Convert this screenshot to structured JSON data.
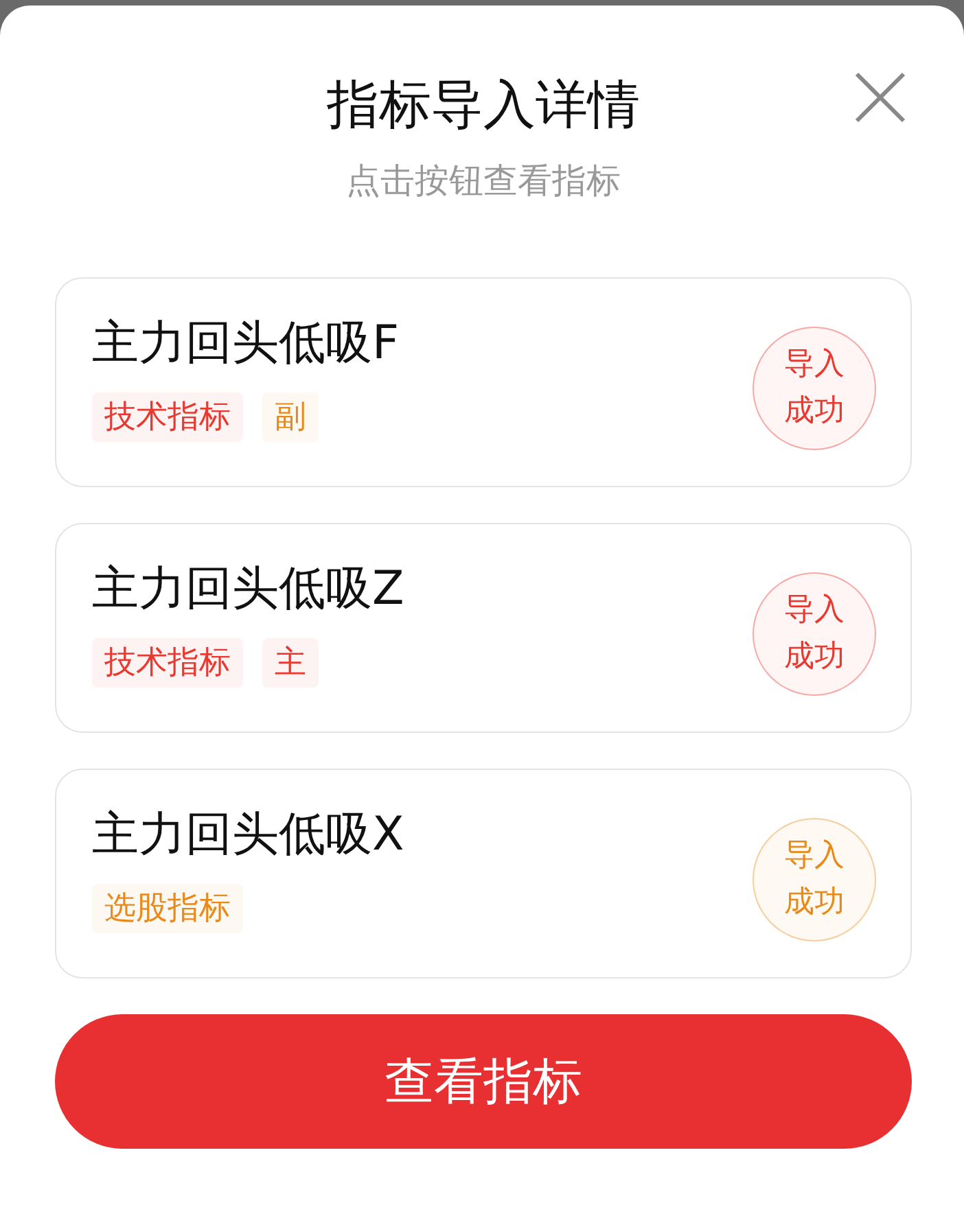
{
  "dialog": {
    "title": "指标导入详情",
    "subtitle": "点击按钮查看指标"
  },
  "items": [
    {
      "name": "主力回头低吸F",
      "tags": [
        {
          "label": "技术指标",
          "color": "#e8382f"
        },
        {
          "label": "副",
          "color": "#e88a1a"
        }
      ],
      "status": {
        "label": [
          "导入",
          "成功"
        ],
        "color": "#e8382f"
      }
    },
    {
      "name": "主力回头低吸Z",
      "tags": [
        {
          "label": "技术指标",
          "color": "#e8382f"
        },
        {
          "label": "主",
          "color": "#e8382f"
        }
      ],
      "status": {
        "label": [
          "导入",
          "成功"
        ],
        "color": "#e8382f"
      }
    },
    {
      "name": "主力回头低吸X",
      "tags": [
        {
          "label": "选股指标",
          "color": "#e88a1a"
        }
      ],
      "status": {
        "label": [
          "导入",
          "成功"
        ],
        "color": "#e88a1a"
      }
    }
  ],
  "primary_button": "查看指标"
}
